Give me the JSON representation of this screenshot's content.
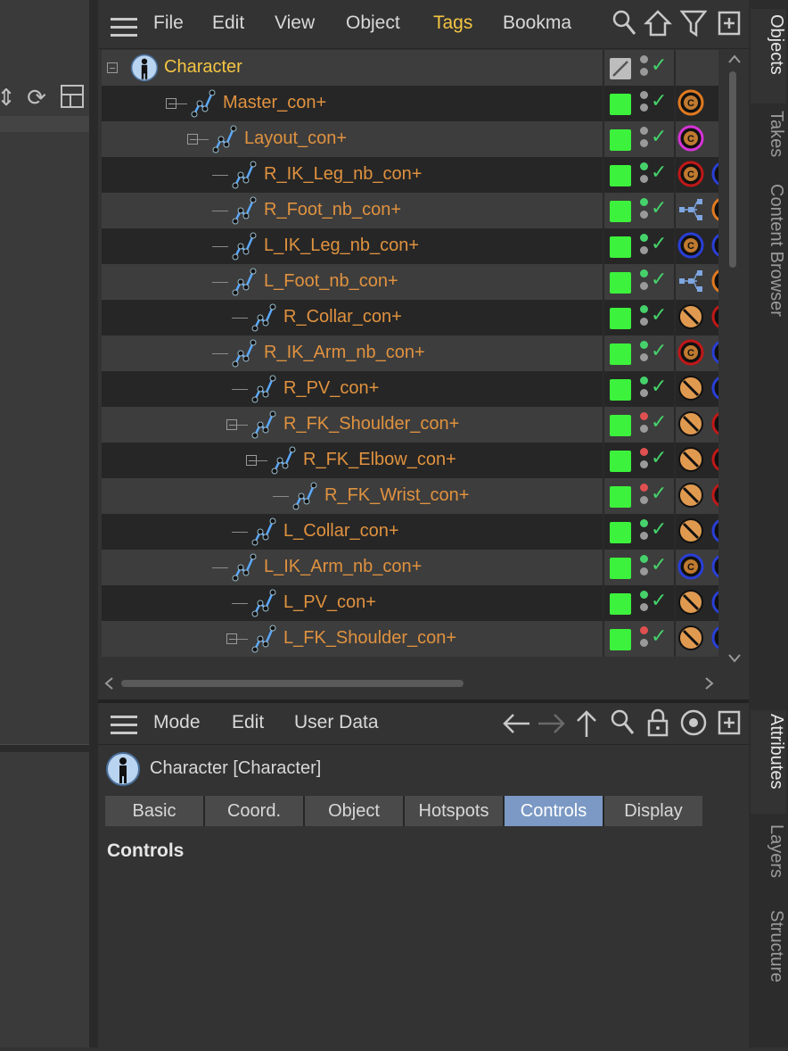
{
  "objects_menu": {
    "file": "File",
    "edit": "Edit",
    "view": "View",
    "object": "Object",
    "tags": "Tags",
    "bookmarks": "Bookma"
  },
  "tree": {
    "rows": [
      {
        "label": "Character",
        "root": true
      },
      {
        "label": "Master_con+"
      },
      {
        "label": "Layout_con+"
      },
      {
        "label": "R_IK_Leg_nb_con+"
      },
      {
        "label": "R_Foot_nb_con+"
      },
      {
        "label": "L_IK_Leg_nb_con+"
      },
      {
        "label": "L_Foot_nb_con+"
      },
      {
        "label": "R_Collar_con+"
      },
      {
        "label": "R_IK_Arm_nb_con+"
      },
      {
        "label": "R_PV_con+"
      },
      {
        "label": "R_FK_Shoulder_con+"
      },
      {
        "label": "R_FK_Elbow_con+"
      },
      {
        "label": "R_FK_Wrist_con+"
      },
      {
        "label": "L_Collar_con+"
      },
      {
        "label": "L_IK_Arm_nb_con+"
      },
      {
        "label": "L_PV_con+"
      },
      {
        "label": "L_FK_Shoulder_con+"
      }
    ]
  },
  "right_tabs": {
    "objects": "Objects",
    "takes": "Takes",
    "content_browser": "Content Browser",
    "attributes": "Attributes",
    "layers": "Layers",
    "structure": "Structure"
  },
  "attr_menu": {
    "mode": "Mode",
    "edit": "Edit",
    "user_data": "User Data"
  },
  "attr": {
    "title": "Character [Character]",
    "tabs": [
      "Basic",
      "Coord.",
      "Object",
      "Hotspots",
      "Controls",
      "Display"
    ],
    "active_tab": "Controls",
    "section": "Controls"
  },
  "colors": {
    "accent": "#7b99c4",
    "label": "#e0923f",
    "root_label": "#f5c542",
    "layer_green": "#3cf23c",
    "check": "#46d26b"
  }
}
